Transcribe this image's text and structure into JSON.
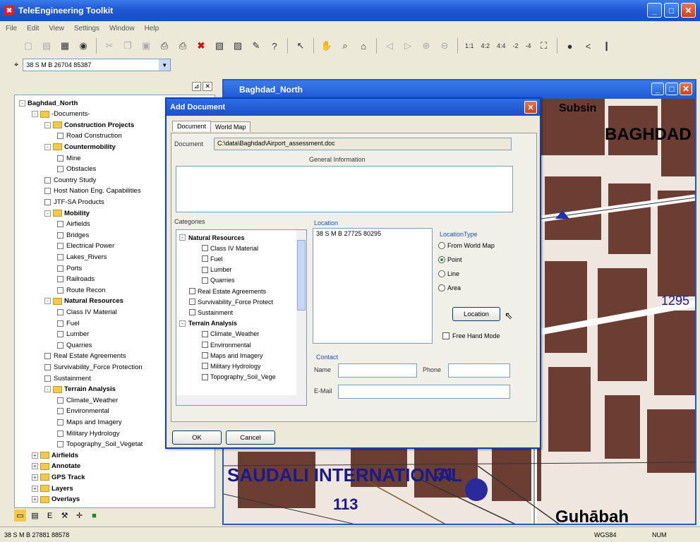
{
  "app": {
    "title": "TeleEngineering Toolkit"
  },
  "menu": [
    "File",
    "Edit",
    "View",
    "Settings",
    "Window",
    "Help"
  ],
  "toolbar": {
    "zoom_labels": [
      "1:1",
      "4:2",
      "4:4",
      "-2",
      "-4"
    ]
  },
  "coordinate": {
    "value": "38 S M B 26704 85387"
  },
  "tree": {
    "items": [
      {
        "label": "Baghdad_North",
        "level": 0,
        "bold": true,
        "expander": "-"
      },
      {
        "label": "-Documents-",
        "level": 1,
        "bold": false,
        "expander": "-",
        "folder": true
      },
      {
        "label": "Construction Projects",
        "level": 2,
        "bold": true,
        "expander": "-",
        "folder": true
      },
      {
        "label": "Road Construction",
        "level": 3,
        "check": true
      },
      {
        "label": "Countermobility",
        "level": 2,
        "bold": true,
        "expander": "-",
        "folder": true
      },
      {
        "label": "Mine",
        "level": 3,
        "check": true
      },
      {
        "label": "Obstacles",
        "level": 3,
        "check": true
      },
      {
        "label": "Country Study",
        "level": 2,
        "check": true
      },
      {
        "label": "Host Nation Eng. Capabilities",
        "level": 2,
        "check": true
      },
      {
        "label": "JTF-SA Products",
        "level": 2,
        "check": true
      },
      {
        "label": "Mobility",
        "level": 2,
        "bold": true,
        "expander": "-",
        "folder": true
      },
      {
        "label": "Airfields",
        "level": 3,
        "check": true
      },
      {
        "label": "Bridges",
        "level": 3,
        "check": true
      },
      {
        "label": "Electrical Power",
        "level": 3,
        "check": true
      },
      {
        "label": "Lakes_Rivers",
        "level": 3,
        "check": true
      },
      {
        "label": "Ports",
        "level": 3,
        "check": true
      },
      {
        "label": "Railroads",
        "level": 3,
        "check": true
      },
      {
        "label": "Route Recon",
        "level": 3,
        "check": true
      },
      {
        "label": "Natural Resources",
        "level": 2,
        "bold": true,
        "expander": "-",
        "folder": true
      },
      {
        "label": "Class IV Material",
        "level": 3,
        "check": true
      },
      {
        "label": "Fuel",
        "level": 3,
        "check": true
      },
      {
        "label": "Lumber",
        "level": 3,
        "check": true
      },
      {
        "label": "Quarries",
        "level": 3,
        "check": true
      },
      {
        "label": "Real Estate Agreements",
        "level": 2,
        "check": true
      },
      {
        "label": "Survivability_Force Protection",
        "level": 2,
        "check": true
      },
      {
        "label": "Sustainment",
        "level": 2,
        "check": true
      },
      {
        "label": "Terrain Analysis",
        "level": 2,
        "bold": true,
        "expander": "-",
        "folder": true
      },
      {
        "label": "Climate_Weather",
        "level": 3,
        "check": true
      },
      {
        "label": "Environmental",
        "level": 3,
        "check": true
      },
      {
        "label": "Maps and Imagery",
        "level": 3,
        "check": true
      },
      {
        "label": "Military Hydrology",
        "level": 3,
        "check": true
      },
      {
        "label": "Topography_Soil_Vegetat",
        "level": 3,
        "check": true
      },
      {
        "label": "Airfields",
        "level": 1,
        "bold": true,
        "expander": "+",
        "folder": true
      },
      {
        "label": "Annotate",
        "level": 1,
        "bold": true,
        "expander": "+",
        "folder": true
      },
      {
        "label": "GPS Track",
        "level": 1,
        "bold": true,
        "expander": "+",
        "folder": true
      },
      {
        "label": "Layers",
        "level": 1,
        "bold": true,
        "expander": "+",
        "folder": true
      },
      {
        "label": "Overlays",
        "level": 1,
        "bold": true,
        "expander": "+",
        "folder": true
      }
    ]
  },
  "map": {
    "title": "Baghdad_North",
    "labels": {
      "subsin": "Subsin",
      "baghdad": "BAGHDAD",
      "saudali": "SAUDALI INTERNATIONAL",
      "n31": "31",
      "n113": "113",
      "n1295": "1295",
      "guhabah": "Guhābah"
    }
  },
  "dialog": {
    "title": "Add Document",
    "tabs": [
      "Document",
      "World Map"
    ],
    "document_label": "Document",
    "document_path": "C:\\data\\Baghdad\\Airport_assessment.doc",
    "general_info_label": "General Information",
    "general_info_value": "",
    "categories_label": "Categories",
    "categories": [
      {
        "label": "Natural Resources",
        "bold": true,
        "expander": "-"
      },
      {
        "label": "Class IV Material",
        "indent": 2,
        "check": true
      },
      {
        "label": "Fuel",
        "indent": 2,
        "check": true
      },
      {
        "label": "Lumber",
        "indent": 2,
        "check": true
      },
      {
        "label": "Quarries",
        "indent": 2,
        "check": true
      },
      {
        "label": "Real Estate Agreements",
        "indent": 1,
        "check": true
      },
      {
        "label": "Survivability_Force Protect",
        "indent": 1,
        "check": true
      },
      {
        "label": "Sustainment",
        "indent": 1,
        "check": true
      },
      {
        "label": "Terrain Analysis",
        "bold": true,
        "expander": "-"
      },
      {
        "label": "Climate_Weather",
        "indent": 2,
        "check": true
      },
      {
        "label": "Environmental",
        "indent": 2,
        "check": true
      },
      {
        "label": "Maps and Imagery",
        "indent": 2,
        "check": true
      },
      {
        "label": "Military Hydrology",
        "indent": 2,
        "check": true
      },
      {
        "label": "Topography_Soil_Vege",
        "indent": 2,
        "check": true
      }
    ],
    "location_label": "Location",
    "location_value": "38 S M B 27725 80295",
    "location_type_label": "LocationType",
    "location_types": [
      {
        "label": "From World Map",
        "selected": false
      },
      {
        "label": "Point",
        "selected": true
      },
      {
        "label": "Line",
        "selected": false
      },
      {
        "label": "Area",
        "selected": false
      }
    ],
    "location_button": "Location",
    "free_hand_label": "Free Hand Mode",
    "contact_label": "Contact",
    "name_label": "Name",
    "name_value": "",
    "phone_label": "Phone",
    "phone_value": "",
    "email_label": "E-Mail",
    "email_value": "",
    "ok_label": "OK",
    "cancel_label": "Cancel"
  },
  "status": {
    "coord": "38 S M B 27881 88578",
    "datum": "WGS84",
    "num": "NUM"
  }
}
